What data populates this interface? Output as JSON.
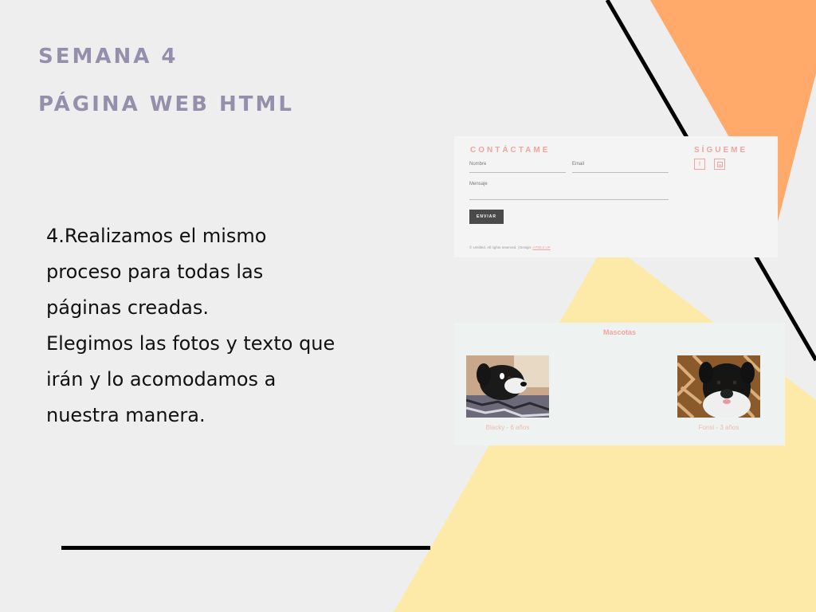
{
  "slide": {
    "heading_line1": "SEMANA 4",
    "heading_line2": "PÁGINA WEB HTML",
    "body_lines": [
      "4.Realizamos el mismo",
      "proceso para todas las",
      "páginas creadas.",
      "Elegimos las fotos y texto que",
      "irán y lo acomodamos a",
      "nuestra manera."
    ]
  },
  "contact_screenshot": {
    "title": "CONTÁCTAME",
    "name_label": "Nombre",
    "email_label": "Email",
    "message_label": "Mensaje",
    "send_label": "ENVIAR",
    "follow_title": "SÍGUEME",
    "social_icons": [
      "facebook-icon",
      "linkedin-icon"
    ],
    "footer_text": "© Untitled. All rights reserved.  |  Design:",
    "footer_link": "HTML5 UP"
  },
  "pets_screenshot": {
    "title": "Mascotas",
    "pets": [
      {
        "caption": "Blacky - 6 años"
      },
      {
        "caption": "Fonsi - 3 años"
      }
    ]
  },
  "colors": {
    "background": "#eeeeee",
    "heading": "#958fac",
    "orange_shape": "#ffa96b",
    "yellow_shape": "#fde9a8",
    "accent_pink": "#f0a5a0"
  }
}
